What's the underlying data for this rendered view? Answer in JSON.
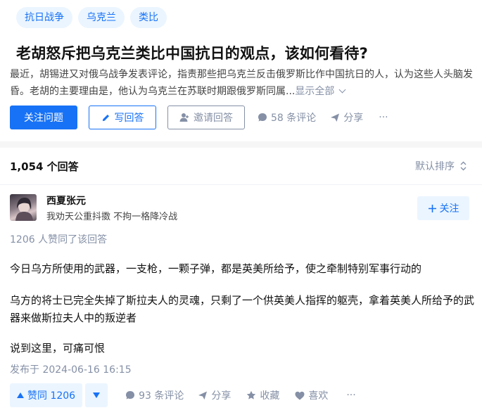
{
  "question": {
    "tags": [
      "抗日战争",
      "乌克兰",
      "类比"
    ],
    "title": "老胡怒斥把乌克兰类比中国抗日的观点，该如何看待?",
    "excerpt": "最近，胡锡进又对俄乌战争发表评论，指责那些把乌克兰反击俄罗斯比作中国抗日的人，认为这些人头脑发昏。老胡的主要理由是，他认为乌克兰在苏联时期跟俄罗斯同属...",
    "show_all": "显示全部",
    "actions": {
      "follow": "关注问题",
      "write": "写回答",
      "invite": "邀请回答",
      "comments": "58 条评论",
      "share": "分享",
      "more": "···"
    }
  },
  "answers_header": {
    "count": "1,054 个回答",
    "sort": "默认排序"
  },
  "answer": {
    "author": {
      "name": "西夏张元",
      "bio": "我劝天公重抖擞 不拘一格降冷战",
      "follow": "关注"
    },
    "vote_meta": "1206 人赞同了该回答",
    "paragraphs": [
      "今日乌方所使用的武器，一支枪，一颗子弹，都是英美所给予，使之牵制特别军事行动的",
      "乌方的将士已完全失掉了斯拉夫人的灵魂，只剩了一个供英美人指挥的躯壳，拿着英美人所给予的武器来做斯拉夫人中的叛逆者",
      "说到这里，可痛可恨"
    ],
    "published": "发布于 2024-06-16 16:15",
    "actions": {
      "upvote": "赞同 1206",
      "comments": "93 条评论",
      "share": "分享",
      "collect": "收藏",
      "like": "喜欢",
      "more": "···"
    }
  },
  "colors": {
    "accent": "#1772f6",
    "accent_bg": "#ebf5ff",
    "muted": "#8590a6"
  }
}
